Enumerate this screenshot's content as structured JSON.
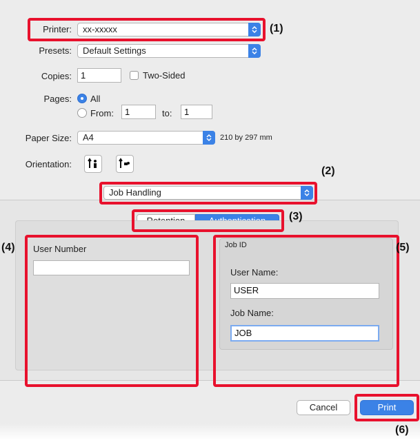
{
  "printer": {
    "label": "Printer:",
    "value": "xx-xxxxx"
  },
  "presets": {
    "label": "Presets:",
    "value": "Default Settings"
  },
  "copies": {
    "label": "Copies:",
    "value": "1",
    "two_sided_label": "Two-Sided"
  },
  "pages": {
    "label": "Pages:",
    "all_label": "All",
    "from_label": "From:",
    "from_value": "1",
    "to_label": "to:",
    "to_value": "1"
  },
  "paper_size": {
    "label": "Paper Size:",
    "value": "A4",
    "dimensions": "210 by 297 mm"
  },
  "orientation": {
    "label": "Orientation:"
  },
  "panel_selector": {
    "value": "Job Handling"
  },
  "tabs": [
    {
      "label": "Retention"
    },
    {
      "label": "Authentication"
    }
  ],
  "user_number": {
    "label": "User Number",
    "value": ""
  },
  "job_id": {
    "title": "Job ID",
    "user_name_label": "User Name:",
    "user_name_value": "USER",
    "job_name_label": "Job Name:",
    "job_name_value": "JOB"
  },
  "buttons": {
    "cancel": "Cancel",
    "print": "Print"
  },
  "callouts": {
    "c1": "(1)",
    "c2": "(2)",
    "c3": "(3)",
    "c4": "(4)",
    "c5": "(5)",
    "c6": "(6)"
  },
  "colors": {
    "accent": "#3b82e6",
    "highlight": "#e8112d",
    "dialog_bg": "#ececec"
  }
}
